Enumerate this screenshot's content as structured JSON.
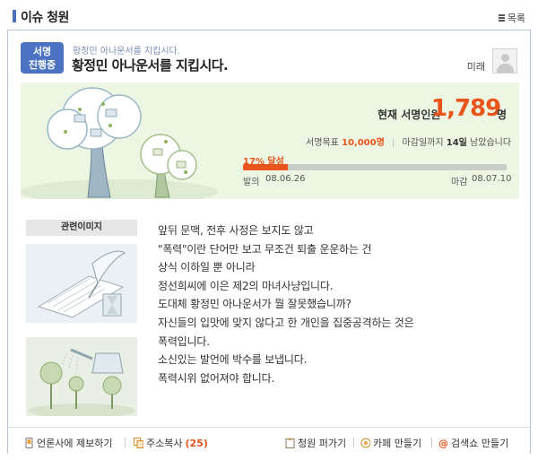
{
  "header": {
    "title": "이슈 청원",
    "list_label": "목록"
  },
  "petition": {
    "status_line1": "서명",
    "status_line2": "진행중",
    "small_title": "황정민 아나운서를 지킵시다.",
    "title": "황정민 아나운서를 지킵시다.",
    "author": "미래"
  },
  "stats": {
    "current_label": "현재 서명인원",
    "current_count": "1,789",
    "current_unit": "명",
    "goal_label": "서명목표",
    "goal_value": "10,000명",
    "deadline_prefix": "마감일까지",
    "deadline_days": "14일",
    "deadline_suffix": "남았습니다",
    "progress_label": "17% 달성",
    "progress_fraction": 0.17,
    "start_label": "발의",
    "start_date": "08.06.26",
    "end_label": "마감",
    "end_date": "08.07.10"
  },
  "images": {
    "label": "관련이미지"
  },
  "body_lines": [
    "앞뒤 문맥, 전후 사정은 보지도 않고",
    "\"폭력\"이란 단어만 보고 무조건 퇴출 운운하는 건",
    "상식 이하일 뿐 아니라",
    "정선희씨에 이은 제2의 마녀사냥입니다.",
    "도대체 황정민 아나운서가 뭘 잘못했습니까?",
    "자신들의 입맛에 맞지 않다고 한 개인을 집중공격하는 것은",
    "폭력입니다.",
    "소신있는 발언에 박수를 보냅니다.",
    "폭력시위 없어져야 합니다."
  ],
  "footer": {
    "report_label": "언론사에 제보하기",
    "copy_label": "주소복사",
    "copy_count": "(25)",
    "edit_label": "청원 퍼가기",
    "cafe_label": "카페 만들기",
    "search_label": "검색쇼 만들기"
  },
  "colors": {
    "accent_orange": "#e8541a",
    "badge_blue": "#4c72c4",
    "banner_bg": "#edf5e3"
  },
  "icons": [
    "list-icon",
    "phone-icon",
    "copy-icon",
    "clipboard-icon",
    "cafe-icon",
    "at-icon"
  ]
}
